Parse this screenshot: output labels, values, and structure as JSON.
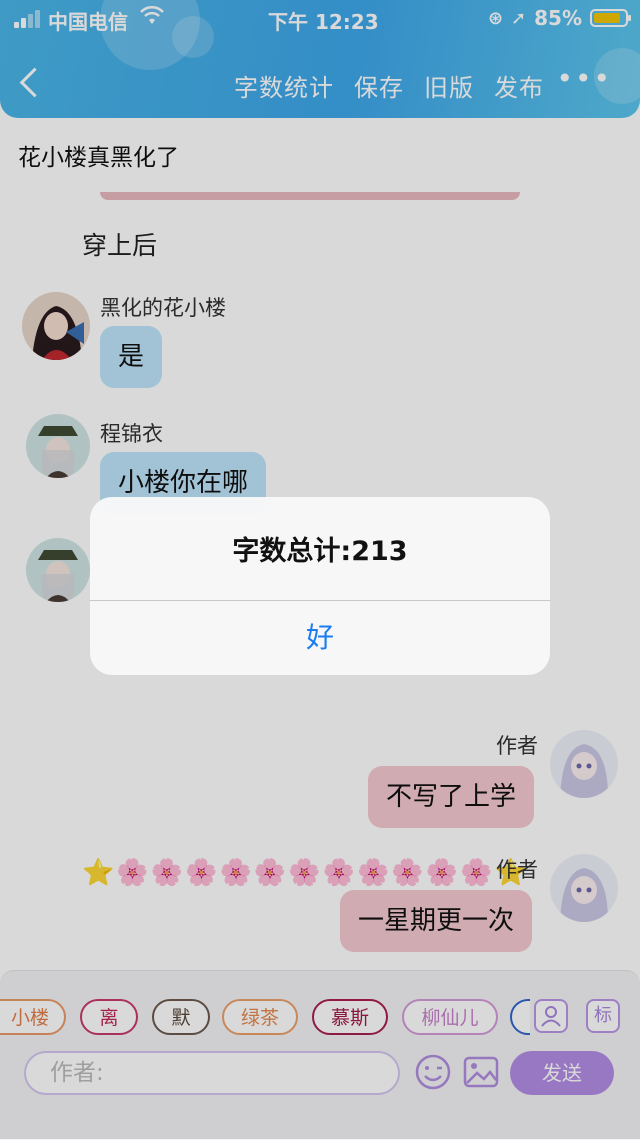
{
  "status_bar": {
    "carrier": "中国电信",
    "time": "下午 12:23",
    "battery_text": "85%",
    "battery_level": 0.85
  },
  "nav": {
    "back_icon": "chevron-left-icon",
    "items": [
      "字数统计",
      "保存",
      "旧版",
      "发布"
    ],
    "more_label": "•••"
  },
  "story_title": "花小楼真黑化了",
  "chat": {
    "scene_text": "穿上后",
    "messages": [
      {
        "sender": "黑化的花小楼",
        "text": "是"
      },
      {
        "sender": "程锦衣",
        "text": "小楼你在哪"
      },
      {
        "sender": "作者",
        "text": "不写了上学"
      },
      {
        "sender": "作者",
        "text": "一星期更一次"
      }
    ],
    "emoji_line": "⭐🌸🌸🌸🌸🌸🌸🌸🌸🌸🌸🌸⭐"
  },
  "bottom": {
    "chips": [
      "小楼",
      "离",
      "默",
      "绿茶",
      "慕斯",
      "柳仙儿"
    ],
    "mark_button": "标",
    "input_placeholder": "作者:",
    "send_label": "发送"
  },
  "dialog": {
    "title": "字数总计:213",
    "ok_label": "好"
  },
  "colors": {
    "header": "#3ea7ea",
    "blue_bubble": "#bfe4fb",
    "pink_bubble": "#f5c9d0",
    "send_button": "#b38ee6",
    "dialog_button": "#1b7ef0"
  }
}
